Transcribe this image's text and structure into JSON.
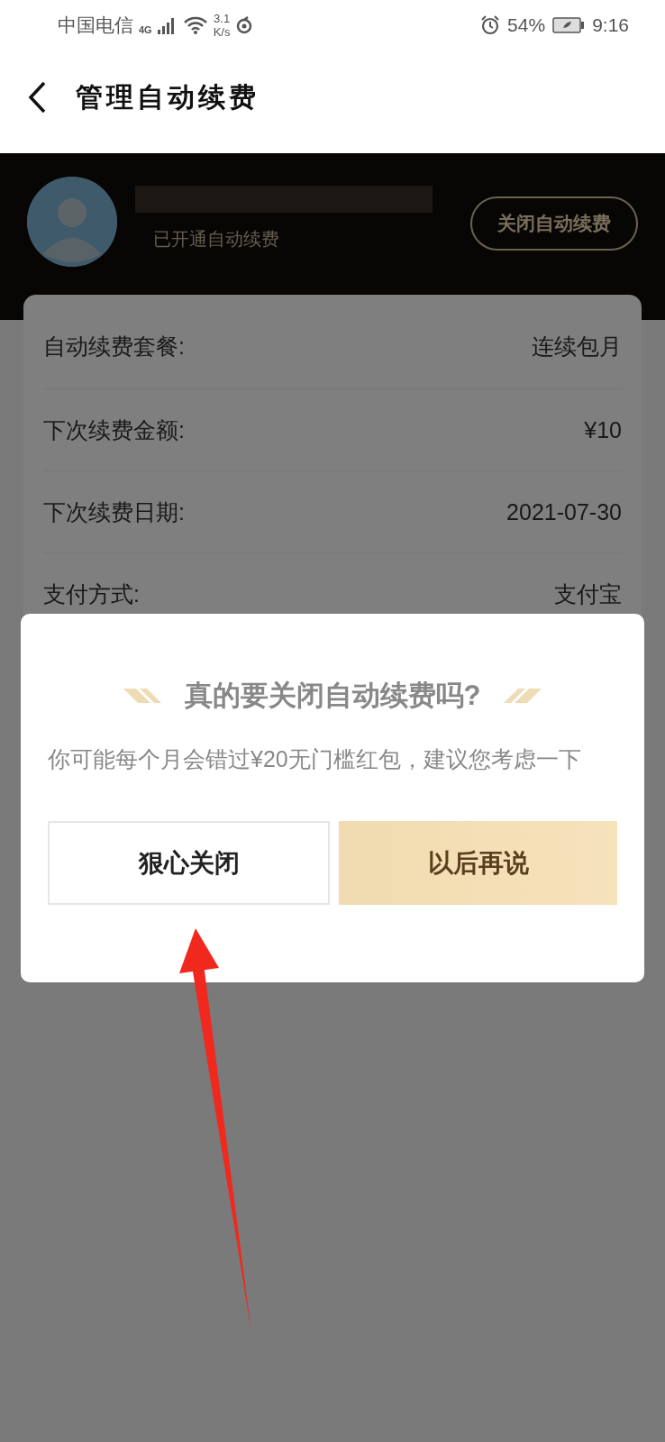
{
  "status_bar": {
    "carrier": "中国电信",
    "network": "4G",
    "speed": [
      "3.1",
      "K/s"
    ],
    "battery": "54%",
    "time": "9:16"
  },
  "nav": {
    "title": "管理自动续费"
  },
  "account": {
    "status": "已开通自动续费",
    "button": "关闭自动续费"
  },
  "details": [
    {
      "label": "自动续费套餐:",
      "value": "连续包月"
    },
    {
      "label": "下次续费金额:",
      "value": "¥10"
    },
    {
      "label": "下次续费日期:",
      "value": "2021-07-30"
    },
    {
      "label": "支付方式:",
      "value": "支付宝"
    }
  ],
  "dialog": {
    "title": "真的要关闭自动续费吗?",
    "message": "你可能每个月会错过¥20无门槛红包，建议您考虑一下",
    "buttons": [
      {
        "label": "狠心关闭",
        "kind": "secondary"
      },
      {
        "label": "以后再说",
        "kind": "primary"
      }
    ]
  }
}
